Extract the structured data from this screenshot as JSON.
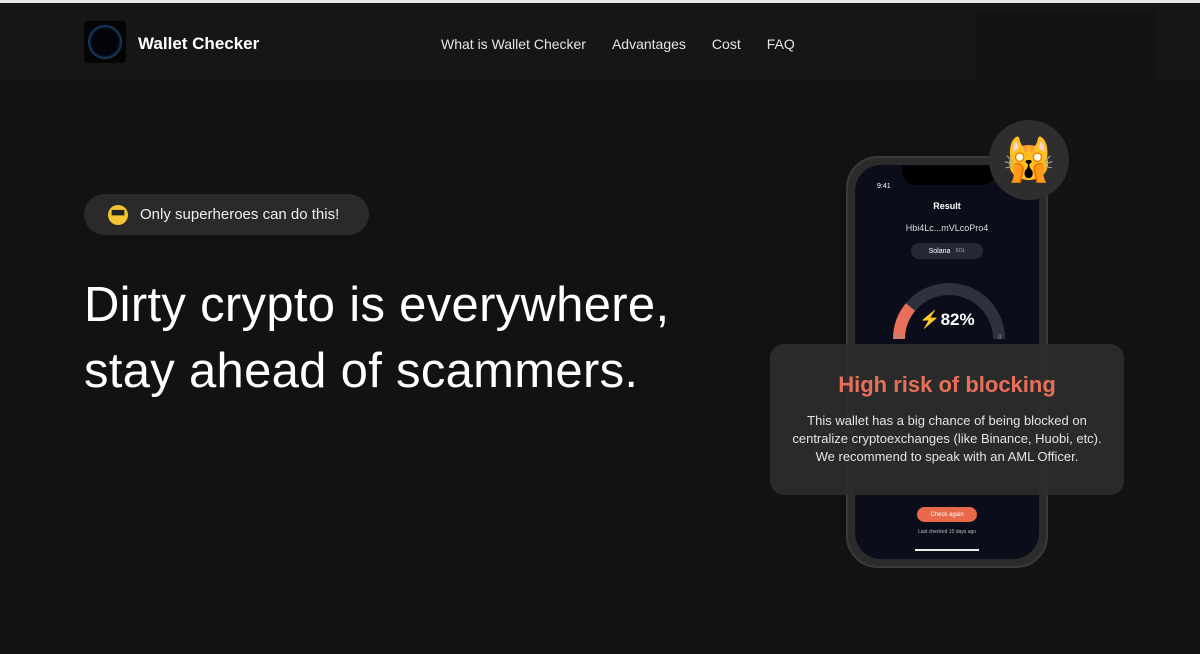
{
  "header": {
    "brand": "Wallet Checker",
    "nav": [
      "What is Wallet Checker",
      "Advantages",
      "Cost",
      "FAQ"
    ]
  },
  "hero": {
    "badge_emoji": "😎",
    "badge": "Only superheroes can do this!",
    "title_line1": "Dirty crypto is everywhere,",
    "title_line2": "stay ahead of scammers."
  },
  "phone": {
    "time": "9:41",
    "title": "Result",
    "address": "Hbi4Lc...mVLcoPro4",
    "chain": "Solana",
    "chain_ticker": "SOL",
    "risk_percent": "82%",
    "risk_value": 82,
    "gauge_min": "100",
    "gauge_max": "0",
    "check_again": "Check again",
    "last_checked": "Last checked 10 days ago",
    "accent": "#e8705a"
  },
  "cat_emoji": "🙀",
  "result_card": {
    "title": "High risk of blocking",
    "text": "This wallet has a big chance of being blocked on centralize cryptoexchanges (like Binance, Huobi, etc). We recommend to speak with an AML Officer."
  }
}
